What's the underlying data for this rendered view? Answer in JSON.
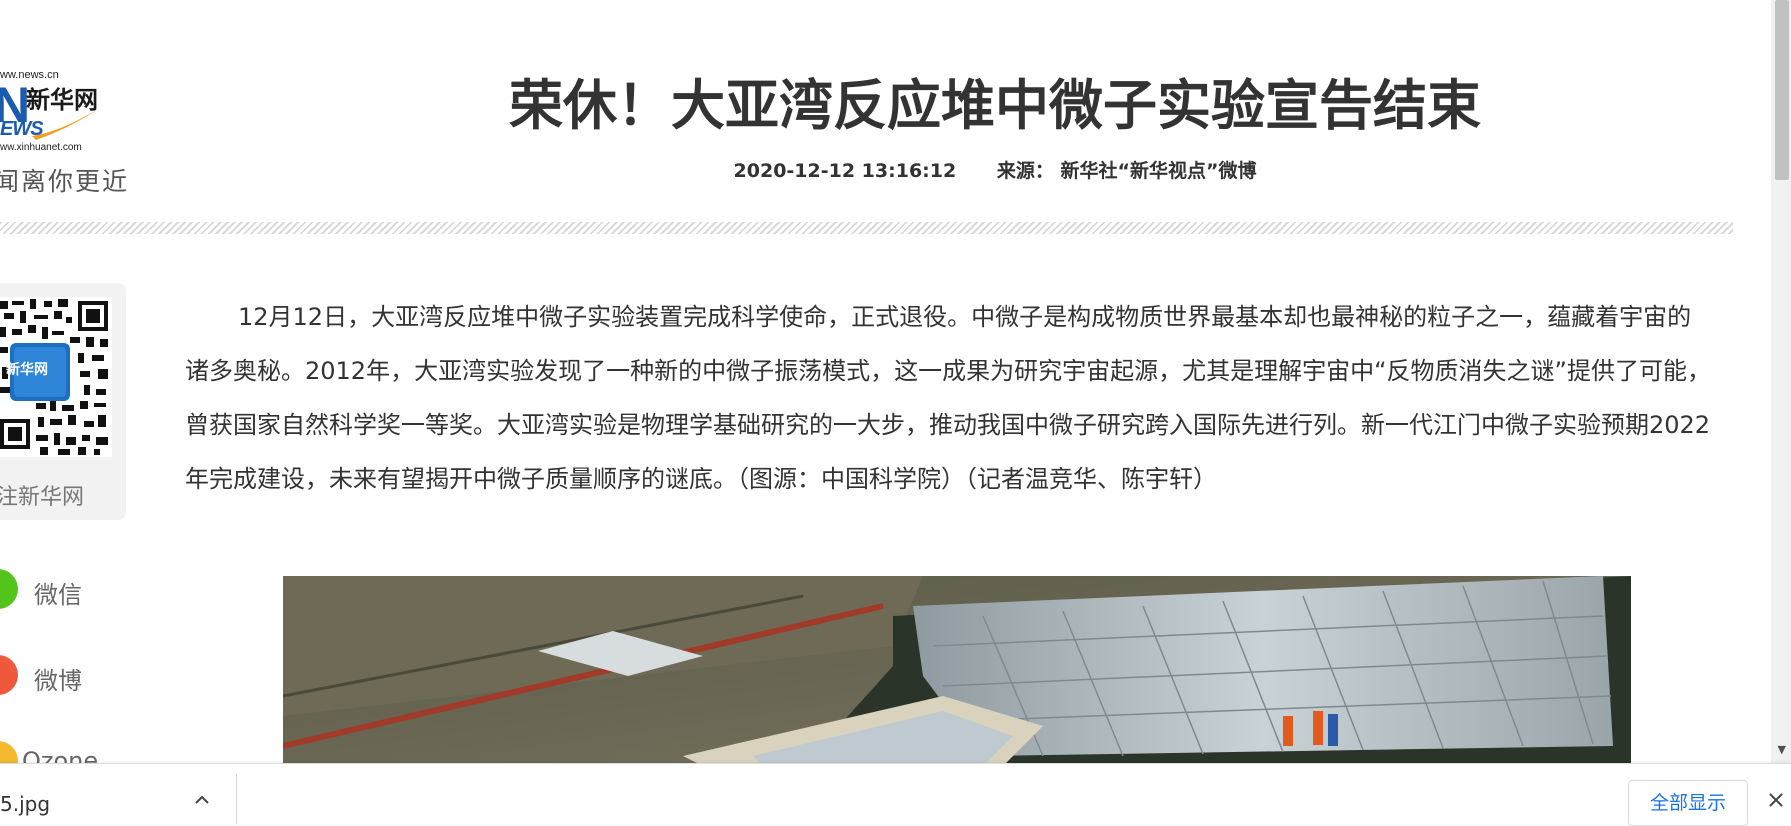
{
  "logo": {
    "url_top": "ww.news.cn",
    "brand": "新华网",
    "news": "EWS",
    "url_bottom": "ww.xinhuanet.com",
    "slogan": "闻离你更近",
    "swoosh_color": "#f0a020"
  },
  "article": {
    "title": "荣休！大亚湾反应堆中微子实验宣告结束",
    "datetime": "2020-12-12 13:16:12",
    "source_label": "来源：",
    "source": "新华社“新华视点”微博",
    "body": "12月12日，大亚湾反应堆中微子实验装置完成科学使命，正式退役。中微子是构成物质世界最基本却也最神秘的粒子之一，蕴藏着宇宙的诸多奥秘。2012年，大亚湾实验发现了一种新的中微子振荡模式，这一成果为研究宇宙起源，尤其是理解宇宙中“反物质消失之谜”提供了可能，曾获国家自然科学奖一等奖。大亚湾实验是物理学基础研究的一大步，推动我国中微子研究跨入国际先进行列。新一代江门中微子实验预期2022年完成建设，未来有望揭开中微子质量顺序的谜底。（图源：中国科学院）（记者温竞华、陈宇轩）"
  },
  "sidebar": {
    "qr_badge": "新华网",
    "qr_caption": "注新华网",
    "share": [
      {
        "label": "微信",
        "color": "#52c41a",
        "icon": "wechat-icon"
      },
      {
        "label": "微博",
        "color": "#f0583c",
        "icon": "weibo-icon"
      },
      {
        "label": "Qzone",
        "color": "#f5b82e",
        "icon": "qzone-icon"
      }
    ]
  },
  "download_bar": {
    "filename": "5.jpg",
    "show_all": "全部显示"
  },
  "colors": {
    "text": "#333333",
    "link_blue": "#1a73e8",
    "brand_blue": "#1c5cb0"
  }
}
